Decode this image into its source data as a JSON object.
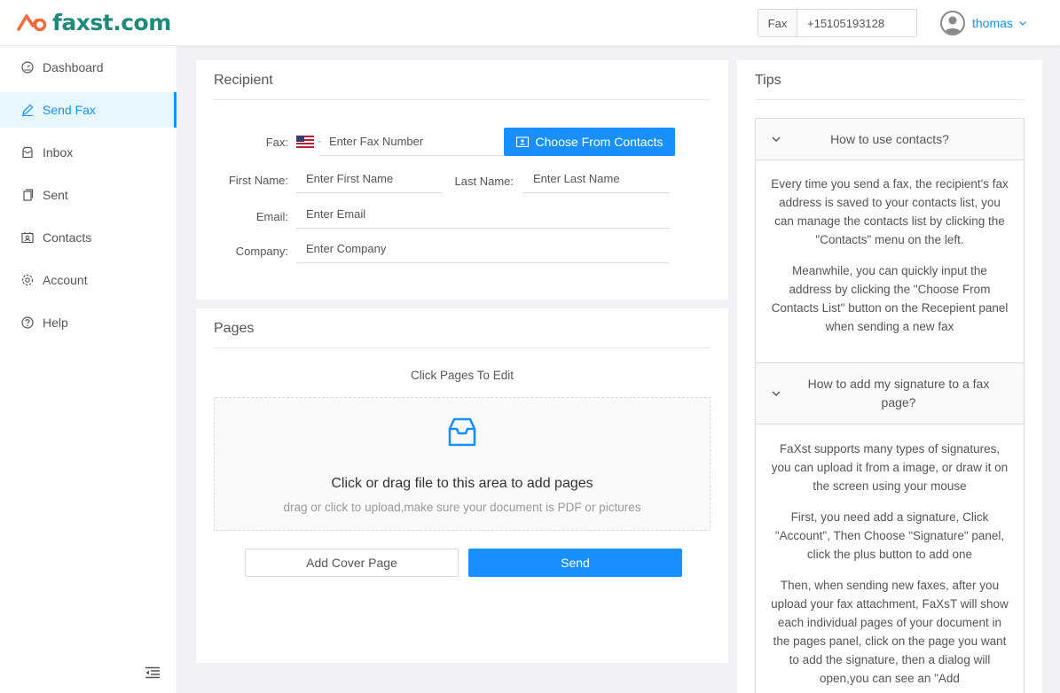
{
  "header": {
    "brand": "faxst.com",
    "fax_label": "Fax",
    "fax_number": "+15105193128",
    "user_name": "thomas"
  },
  "sidebar": {
    "items": [
      {
        "label": "Dashboard",
        "icon": "dashboard-icon"
      },
      {
        "label": "Send Fax",
        "icon": "edit-icon",
        "active": true
      },
      {
        "label": "Inbox",
        "icon": "inbox-icon"
      },
      {
        "label": "Sent",
        "icon": "copy-icon"
      },
      {
        "label": "Contacts",
        "icon": "contacts-icon"
      },
      {
        "label": "Account",
        "icon": "setting-icon"
      },
      {
        "label": "Help",
        "icon": "question-circle-icon"
      }
    ]
  },
  "recipient": {
    "title": "Recipient",
    "fax_label": "Fax:",
    "fax_placeholder": "Enter Fax Number",
    "choose_contacts_label": "Choose From Contacts",
    "first_name_label": "First Name:",
    "first_name_placeholder": "Enter First Name",
    "last_name_label": "Last Name:",
    "last_name_placeholder": "Enter Last Name",
    "email_label": "Email:",
    "email_placeholder": "Enter Email",
    "company_label": "Company:",
    "company_placeholder": "Enter Company"
  },
  "pages": {
    "title": "Pages",
    "hint": "Click Pages To Edit",
    "drop_title": "Click or drag file to this area to add pages",
    "drop_hint": "drag or click to upload,make sure your document is PDF or pictures",
    "add_cover_label": "Add Cover Page",
    "send_label": "Send"
  },
  "tips": {
    "title": "Tips",
    "sections": [
      {
        "question": "How to use contacts?",
        "paragraphs": [
          "Every time you send a fax, the recipient's fax address is saved to your contacts list, you can manage the contacts list by clicking the \"Contacts\" menu on the left.",
          "Meanwhile, you can quickly input the address by clicking the \"Choose From Contacts List\" button on the Recepient panel when sending a new fax"
        ]
      },
      {
        "question": "How to add my signature to a fax page?",
        "paragraphs": [
          "FaXst supports many types of signatures, you can upload it from a image, or draw it on the screen using your mouse",
          "First, you need add a signature, Click \"Account\", Then Choose \"Signature\" panel, click the plus button to add one",
          "Then, when sending new faxes, after you upload your fax attachment, FaXsT will show each individual pages of your document in the pages panel, click on the page you want to add the signature, then a dialog will open,you can see an \"Add"
        ]
      }
    ]
  },
  "colors": {
    "primary": "#1890ff",
    "brand_green": "#1f8a7a",
    "brand_orange": "#f26a3a"
  }
}
